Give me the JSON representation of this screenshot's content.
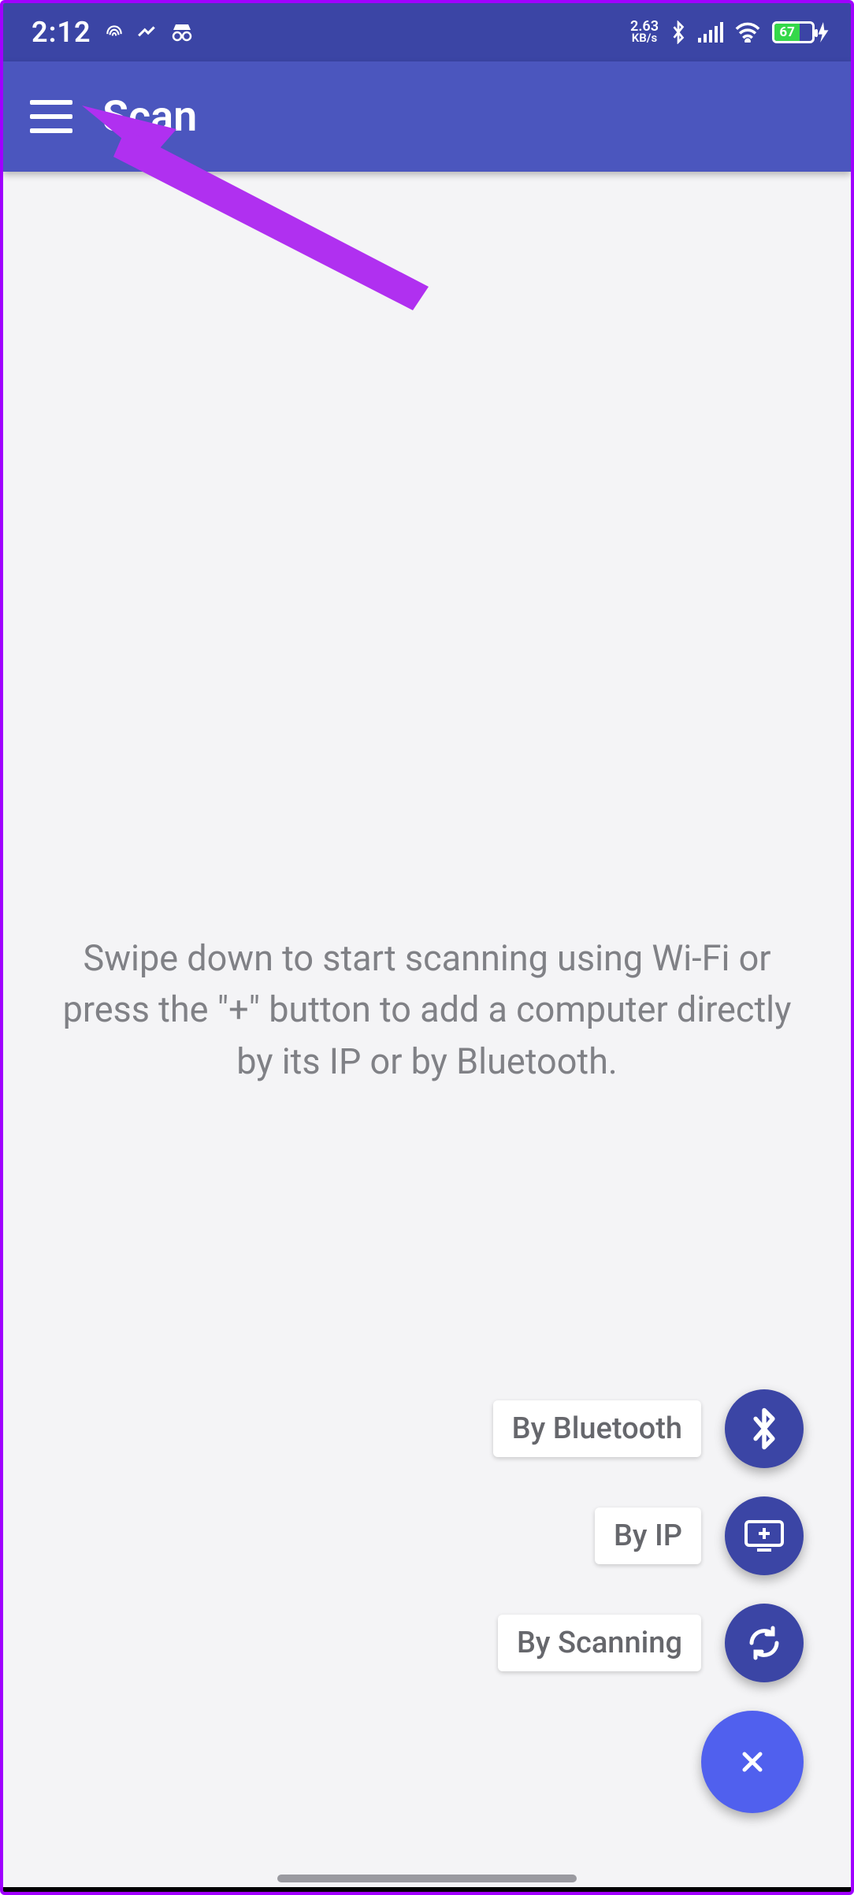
{
  "status": {
    "time": "2:12",
    "net_rate_value": "2.63",
    "net_rate_unit": "KB/s",
    "battery_pct": "67"
  },
  "appbar": {
    "title": "Scan"
  },
  "hint": "Swipe down to start scanning using Wi-Fi or press the \"+\" button to add a computer directly by its IP or by Bluetooth.",
  "fab": {
    "bluetooth_label": "By Bluetooth",
    "ip_label": "By IP",
    "scanning_label": "By Scanning"
  }
}
